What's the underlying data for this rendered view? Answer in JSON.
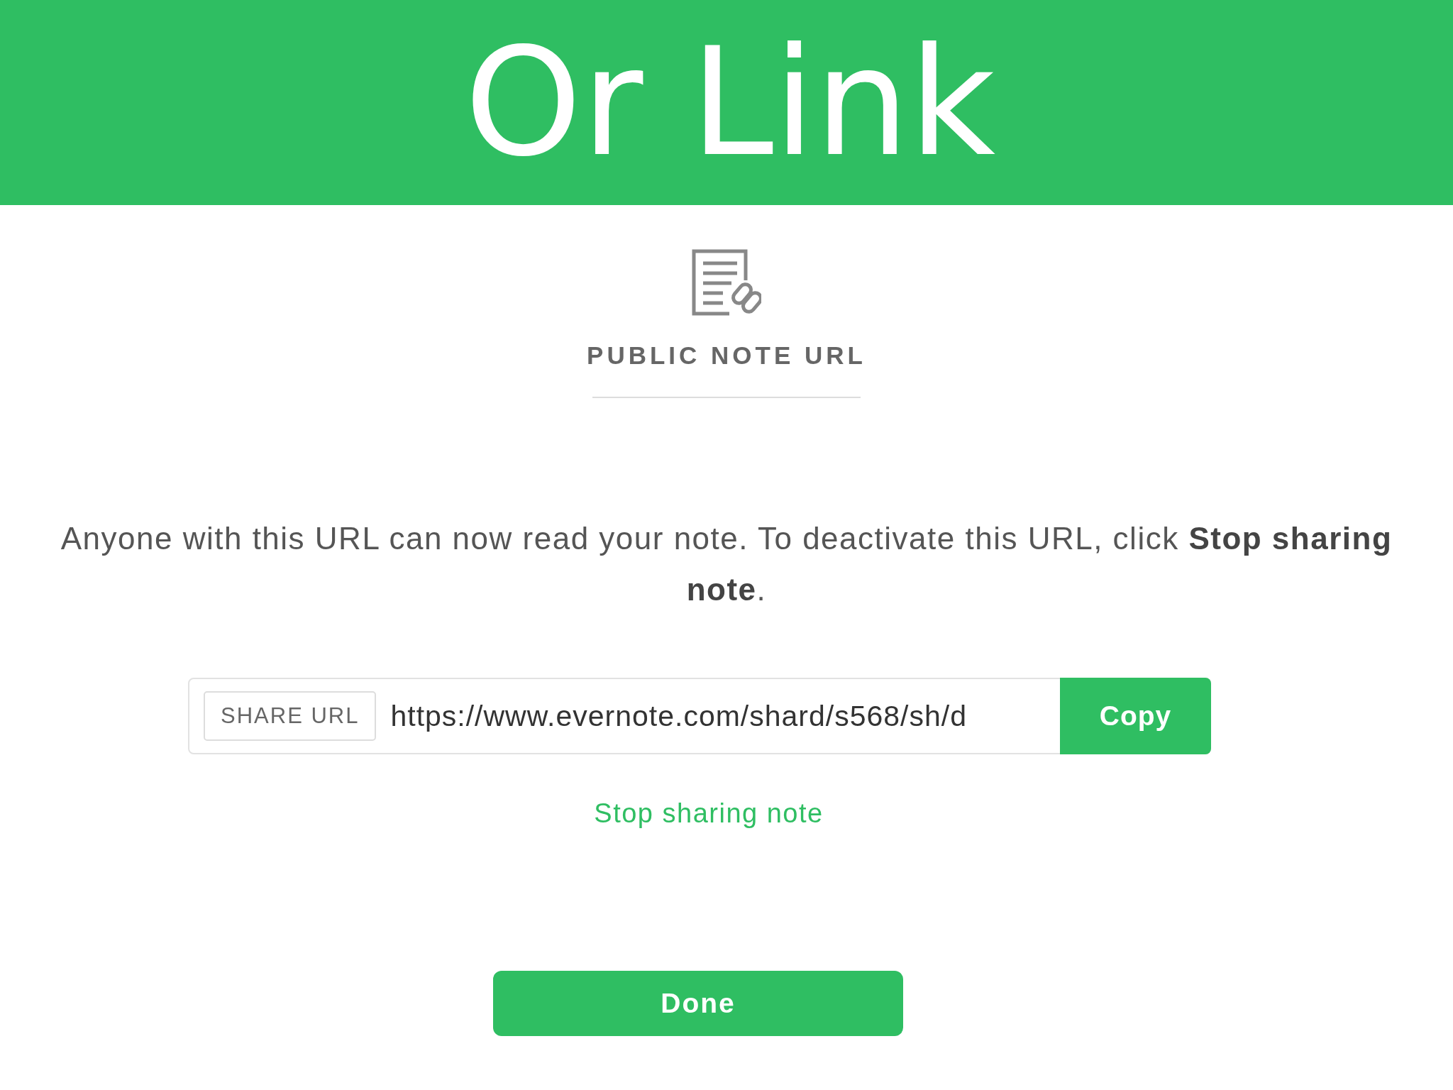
{
  "banner": {
    "title": "Or Link"
  },
  "dialog": {
    "heading": "PUBLIC NOTE URL",
    "message": "Anyone with this URL can now read your note. To deactivate this URL, click **Stop sharing note**.",
    "share_url": {
      "label": "SHARE URL",
      "value": "https://www.evernote.com/shard/s568/sh/d",
      "button": "Copy"
    },
    "stop_link": "Stop sharing note",
    "done_button": "Done"
  }
}
